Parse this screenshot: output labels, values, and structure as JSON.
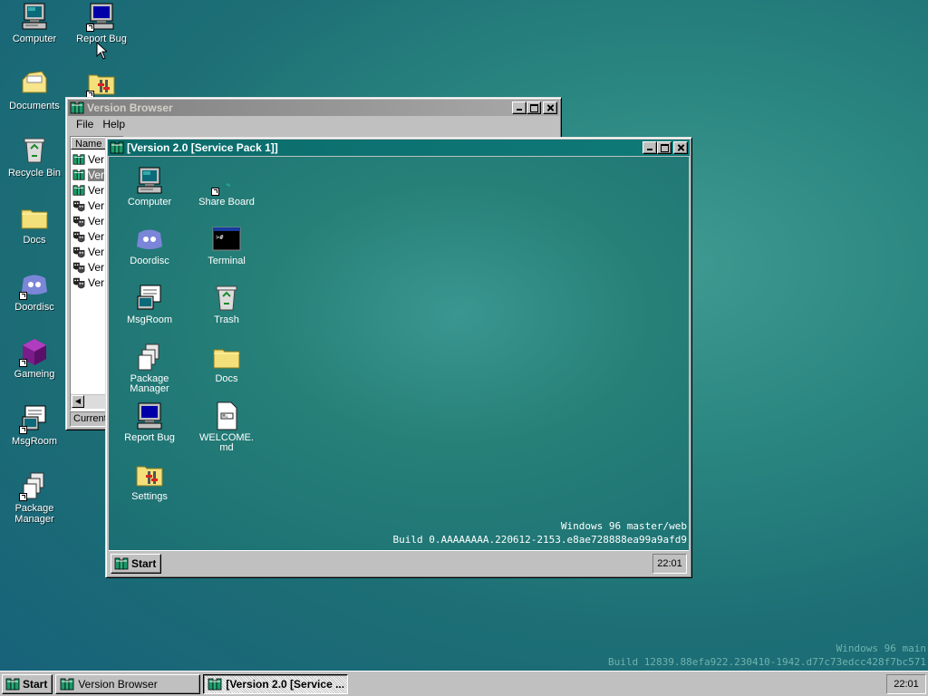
{
  "desktop": {
    "icons": [
      {
        "label": "Computer"
      },
      {
        "label": "Report Bug"
      },
      {
        "label": "Documents"
      },
      {
        "label": "Recycle Bin"
      },
      {
        "label": "Docs"
      },
      {
        "label": "Doordisc"
      },
      {
        "label": "Gameing"
      },
      {
        "label": "MsgRoom"
      },
      {
        "label": "Package Manager"
      }
    ],
    "watermark_line1": "Windows 96 main",
    "watermark_line2": "Build 12839.88efa922.230410-1942.d77c73edcc428f7bc571"
  },
  "version_browser": {
    "title": "Version Browser",
    "menu": [
      "File",
      "Help"
    ],
    "column_header": "Name",
    "rows": [
      "Ver",
      "Ver",
      "Ver",
      "Ver",
      "Ver",
      "Ver",
      "Ver",
      "Ver",
      "Ver"
    ],
    "status": "Current"
  },
  "vm_window": {
    "title": "[Version 2.0 [Service Pack 1]]",
    "icons": [
      {
        "label": "Computer"
      },
      {
        "label": "Share Board"
      },
      {
        "label": "Doordisc"
      },
      {
        "label": "Terminal"
      },
      {
        "label": "MsgRoom"
      },
      {
        "label": "Trash"
      },
      {
        "label": "Package Manager"
      },
      {
        "label": "Docs"
      },
      {
        "label": "Report Bug"
      },
      {
        "label": "WELCOME.md"
      },
      {
        "label": "Settings"
      }
    ],
    "watermark_line1": "Windows 96 master/web",
    "watermark_line2": "Build 0.AAAAAAAA.220612-2153.e8ae728888ea99a9afd9",
    "taskbar": {
      "start_label": "Start",
      "clock": "22:01"
    }
  },
  "taskbar": {
    "start_label": "Start",
    "buttons": [
      {
        "label": "Version Browser"
      },
      {
        "label": "[Version 2.0 [Service ..."
      }
    ],
    "clock": "22:01"
  },
  "colors": {
    "titlebar_active": "#0c6b6b",
    "face": "#c0c0c0",
    "desktop": "#1f7479"
  }
}
